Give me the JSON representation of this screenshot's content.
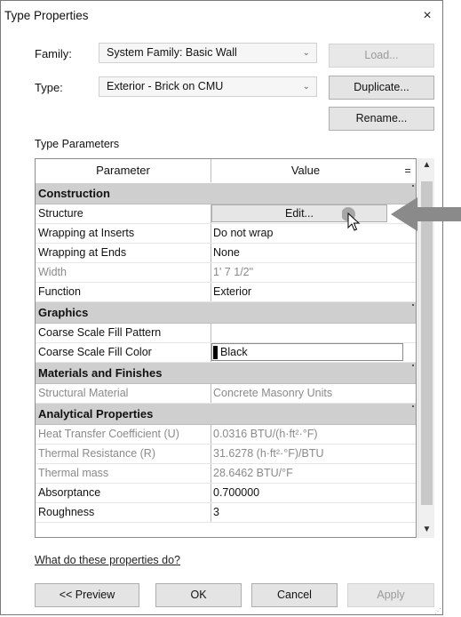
{
  "window": {
    "title": "Type Properties",
    "close_symbol": "×"
  },
  "family": {
    "label": "Family:",
    "value": "System Family: Basic Wall"
  },
  "type": {
    "label": "Type:",
    "value": "Exterior - Brick on CMU"
  },
  "buttons": {
    "load": "Load...",
    "duplicate": "Duplicate...",
    "rename": "Rename..."
  },
  "section_label": "Type Parameters",
  "grid": {
    "header_parameter": "Parameter",
    "header_value": "Value",
    "header_sort": "=",
    "rows": [
      {
        "kind": "category",
        "parameter": "Construction"
      },
      {
        "kind": "edit",
        "parameter": "Structure",
        "value": "Edit..."
      },
      {
        "kind": "normal",
        "parameter": "Wrapping at Inserts",
        "value": "Do not wrap"
      },
      {
        "kind": "normal",
        "parameter": "Wrapping at Ends",
        "value": "None"
      },
      {
        "kind": "muted",
        "parameter": "Width",
        "value": "1'  7 1/2\""
      },
      {
        "kind": "normal",
        "parameter": "Function",
        "value": "Exterior"
      },
      {
        "kind": "category",
        "parameter": "Graphics"
      },
      {
        "kind": "normal",
        "parameter": "Coarse Scale Fill Pattern",
        "value": ""
      },
      {
        "kind": "color",
        "parameter": "Coarse Scale Fill Color",
        "value": "Black"
      },
      {
        "kind": "category",
        "parameter": "Materials and Finishes"
      },
      {
        "kind": "muted",
        "parameter": "Structural Material",
        "value": "Concrete Masonry Units"
      },
      {
        "kind": "category",
        "parameter": "Analytical Properties"
      },
      {
        "kind": "muted",
        "parameter": "Heat Transfer Coefficient (U)",
        "value": "0.0316 BTU/(h·ft²·°F)"
      },
      {
        "kind": "muted",
        "parameter": "Thermal Resistance (R)",
        "value": "31.6278 (h·ft²·°F)/BTU"
      },
      {
        "kind": "muted",
        "parameter": "Thermal mass",
        "value": "28.6462 BTU/°F"
      },
      {
        "kind": "normal",
        "parameter": "Absorptance",
        "value": "0.700000"
      },
      {
        "kind": "normal",
        "parameter": "Roughness",
        "value": "3"
      }
    ]
  },
  "help_link": "What do these properties do?",
  "footer": {
    "preview": "<< Preview",
    "ok": "OK",
    "cancel": "Cancel",
    "apply": "Apply"
  },
  "colors": {
    "swatch": "#000000",
    "category_bg": "#cfcfcf",
    "pointer_arrow": "#8a8a8a"
  }
}
